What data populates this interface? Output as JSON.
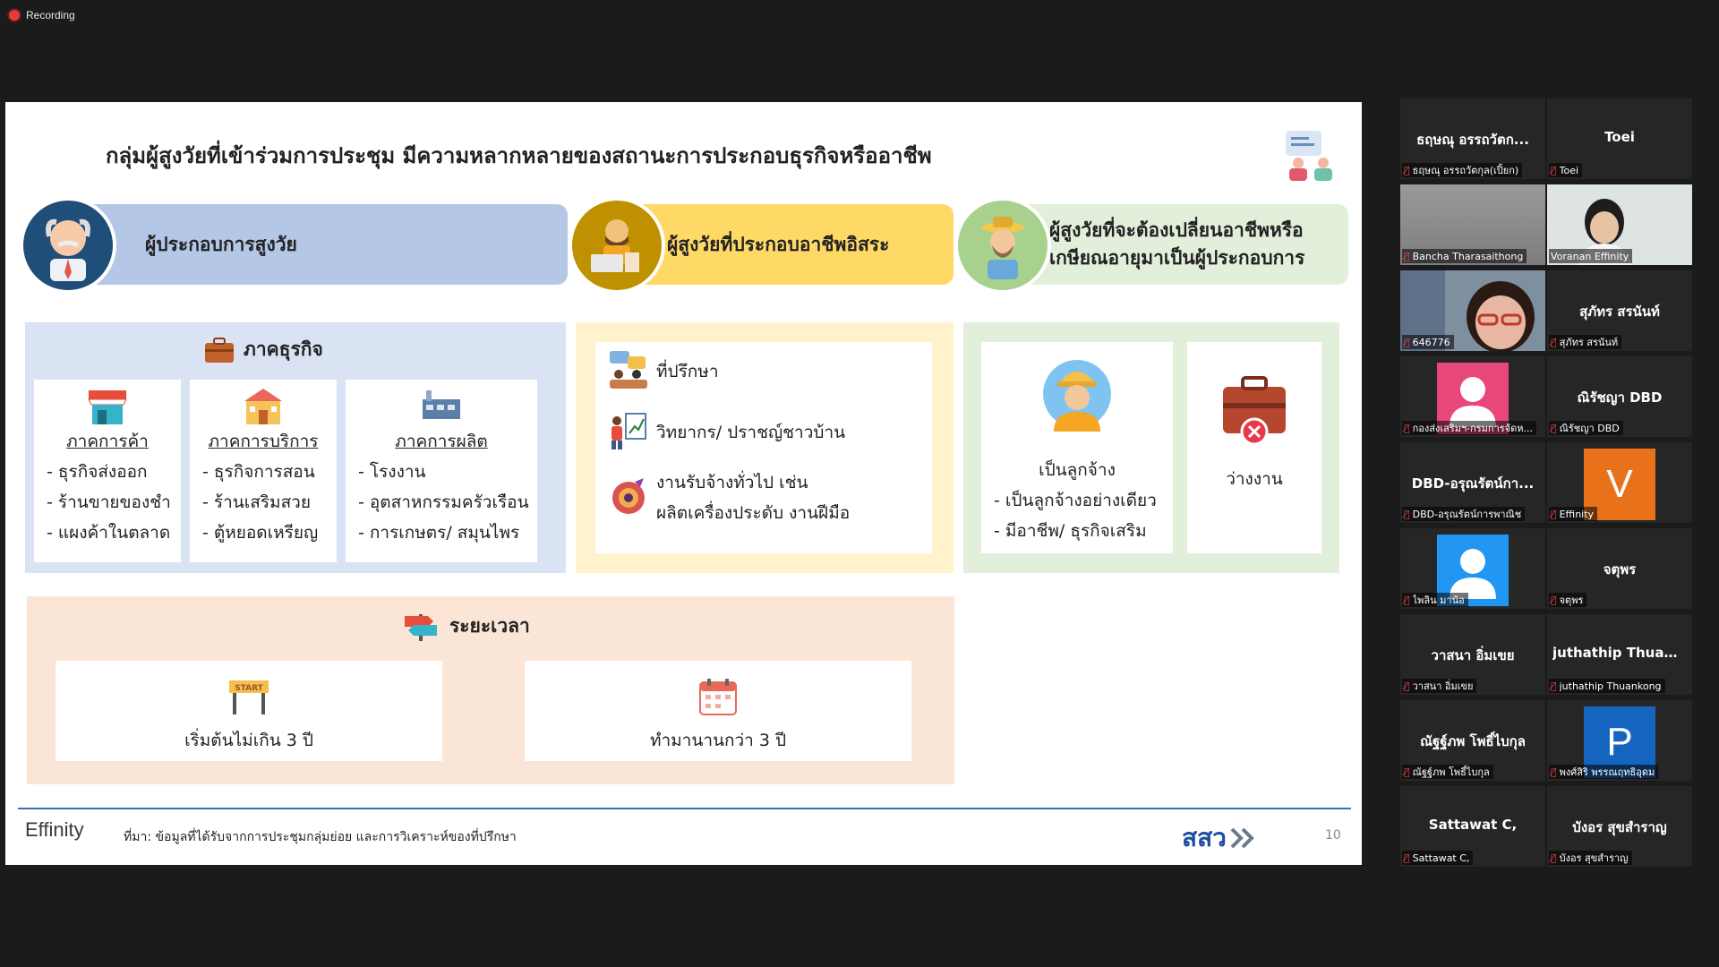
{
  "recording": {
    "label": "Recording"
  },
  "slide": {
    "title": "กลุ่มผู้สูงวัยที่เข้าร่วมการประชุม มีความหลากหลายของสถานะการประกอบธุรกิจหรืออาชีพ",
    "categories": [
      {
        "label": "ผู้ประกอบการสูงวัย",
        "color": "#b4c7e7",
        "avatar_bg": "#1f4e79"
      },
      {
        "label": "ผู้สูงวัยที่ประกอบอาชีพอิสระ",
        "color": "#ffd966",
        "avatar_bg": "#bf9000"
      },
      {
        "label_line1": "ผู้สูงวัยที่จะต้องเปลี่ยนอาชีพหรือ",
        "label_line2": "เกษียณอายุมาเป็นผู้ประกอบการ",
        "color": "#e2efda",
        "avatar_bg": "#a9d18e"
      }
    ],
    "business": {
      "title": "ภาคธุรกิจ",
      "color": "#dae3f3",
      "cards": [
        {
          "header": "ภาคการค้า",
          "items": [
            "- ธุรกิจส่งออก",
            "- ร้านขายของชำ",
            "- แผงค้าในตลาด"
          ]
        },
        {
          "header": "ภาคการบริการ",
          "items": [
            "- ธุรกิจการสอน",
            "- ร้านเสริมสวย",
            "- ตู้หยอดเหรียญ"
          ]
        },
        {
          "header": "ภาคการผลิต",
          "items": [
            "- โรงงาน",
            "- อุตสาหกรรมครัวเรือน",
            "- การเกษตร/ สมุนไพร"
          ]
        }
      ]
    },
    "freelance": {
      "color": "#fff2cc",
      "items": [
        "ที่ปรึกษา",
        "วิทยากร/ ปราชญ์ชาวบ้าน",
        "งานรับจ้างทั่วไป เช่น",
        "ผลิตเครื่องประดับ งานฝีมือ"
      ]
    },
    "employment": {
      "color": "#e2efda",
      "employee": {
        "label": "เป็นลูกจ้าง",
        "items": [
          "- เป็นลูกจ้างอย่างเดียว",
          "- มีอาชีพ/ ธุรกิจเสริม"
        ]
      },
      "unemployed": {
        "label": "ว่างงาน"
      }
    },
    "period": {
      "title": "ระยะเวลา",
      "color": "#fbe5d6",
      "items": [
        "เริ่มต้นไม่เกิน 3 ปี",
        "ทำมานานกว่า 3 ปี"
      ],
      "start_sign": "START"
    },
    "footer": {
      "logo": "Effinity",
      "source": "ที่มา: ข้อมูลที่ได้รับจากการประชุมกลุ่มย่อย และการวิเคราะห์ของที่ปรึกษา",
      "brand": "สสว",
      "page": "10"
    }
  },
  "participants": [
    {
      "display": "ธฤษณุ อรรถวัตก...",
      "name": "ธฤษณุ อรรถวัตกุล(เปิ้ยก)"
    },
    {
      "display": "Toei",
      "name": "Toei"
    },
    {
      "display": "",
      "name": "Bancha Tharasaithong",
      "video": true
    },
    {
      "display": "",
      "name": "Voranan Effinity",
      "video": true,
      "active": true
    },
    {
      "display": "",
      "name": "646776",
      "video": true
    },
    {
      "display": "สุภัทร สรนันท์",
      "name": "สุภัทร สรนันท์"
    },
    {
      "display": "",
      "name": "กองส่งเสริมฯ-กรมการจัดห...",
      "avatar": "person-pink"
    },
    {
      "display": "ณิรัชญา DBD",
      "name": "ณิรัชญา DBD"
    },
    {
      "display": "DBD-อรุณรัตน์กา...",
      "name": "DBD-อรุณรัตน์การพาณิช"
    },
    {
      "display": "",
      "name": "Effinity",
      "letter": "V",
      "letter_color": "#e8711a"
    },
    {
      "display": "",
      "name": "ไพลิน มาน้อ",
      "avatar": "person-blue"
    },
    {
      "display": "จตุพร",
      "name": "จตุพร"
    },
    {
      "display": "วาสนา อิ่มเขย",
      "name": "วาสนา อิ่มเขย"
    },
    {
      "display": "juthathip  Thuan...",
      "name": "juthathip Thuankong"
    },
    {
      "display": "ณัฐฐ์ภพ โพธิ์ไบกุล",
      "name": "ณัฐฐ์ภพ โพธิ์ไบกุล"
    },
    {
      "display": "",
      "name": "พงศ์สิริ พรรณฤทธิอุดม",
      "letter": "P",
      "letter_color": "#1565c0"
    },
    {
      "display": "Sattawat C,",
      "name": "Sattawat C,"
    },
    {
      "display": "บังอร สุขสำราญ",
      "name": "บังอร สุขสำราญ"
    }
  ]
}
